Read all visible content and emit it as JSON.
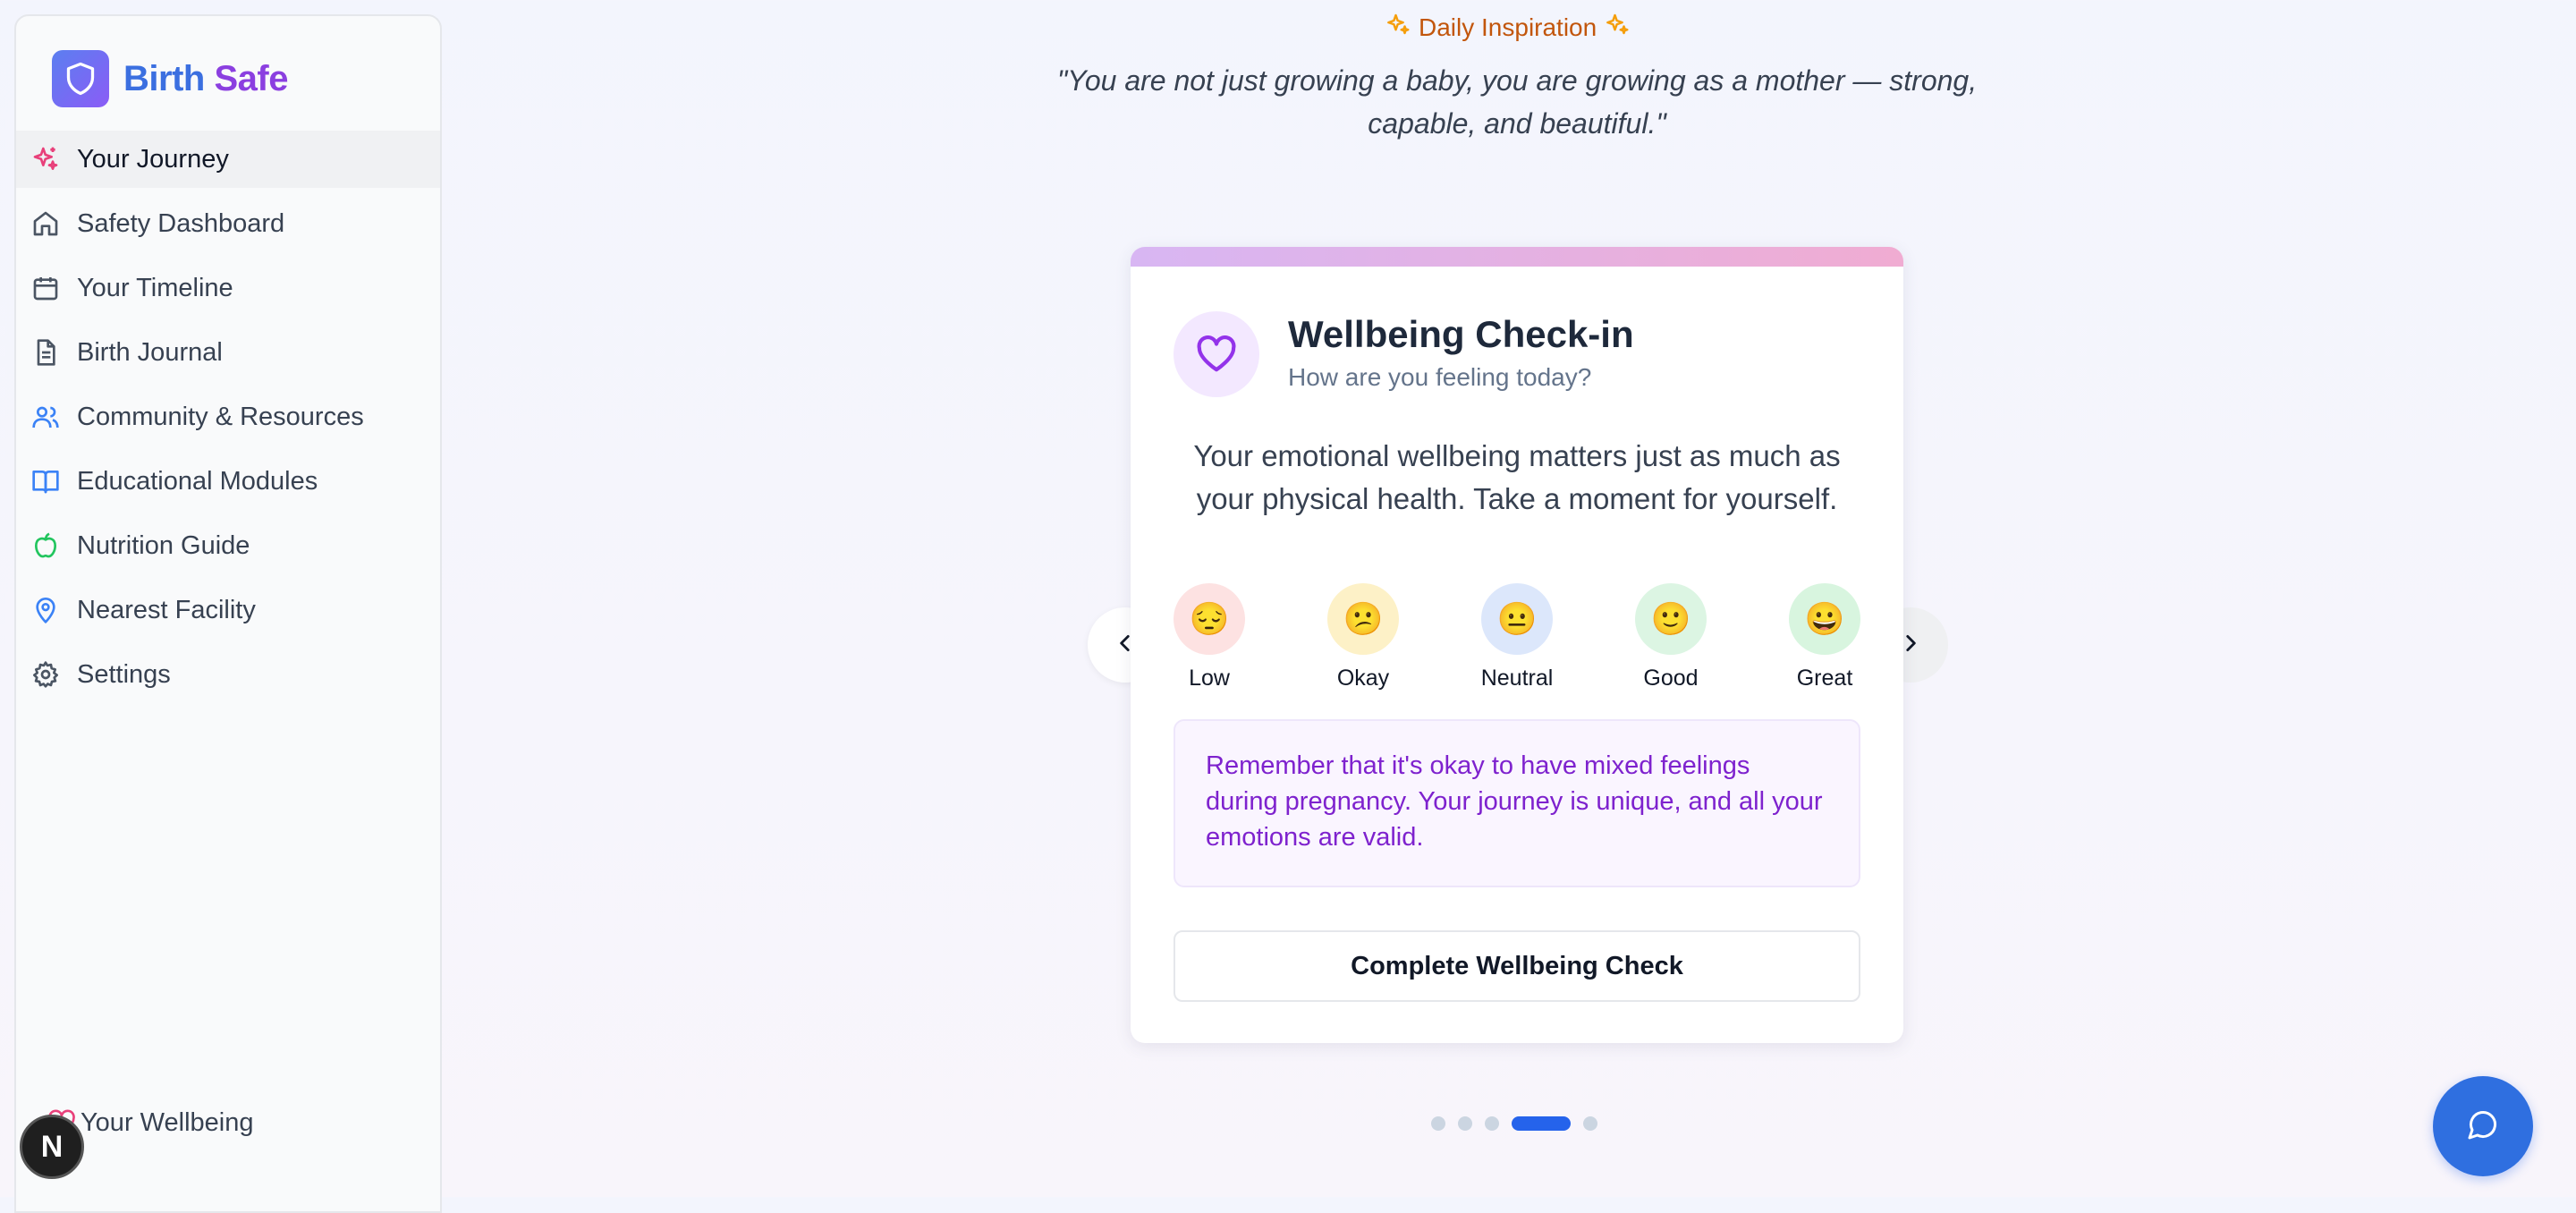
{
  "app": {
    "name_part1": "Birth",
    "name_part2": "Safe"
  },
  "sidebar": {
    "items": [
      {
        "label": "Your Journey",
        "icon": "sparkles-icon"
      },
      {
        "label": "Safety Dashboard",
        "icon": "home-icon"
      },
      {
        "label": "Your Timeline",
        "icon": "calendar-icon"
      },
      {
        "label": "Birth Journal",
        "icon": "document-icon"
      },
      {
        "label": "Community & Resources",
        "icon": "users-icon"
      },
      {
        "label": "Educational Modules",
        "icon": "book-icon"
      },
      {
        "label": "Nutrition Guide",
        "icon": "apple-icon"
      },
      {
        "label": "Nearest Facility",
        "icon": "map-pin-icon"
      },
      {
        "label": "Settings",
        "icon": "gear-icon"
      }
    ],
    "footer_label": "Your Wellbeing",
    "badge_letter": "N"
  },
  "inspiration": {
    "label": "Daily Inspiration",
    "quote": "\"You are not just growing a baby, you are growing as a mother — strong, capable, and beautiful.\""
  },
  "card": {
    "title": "Wellbeing Check-in",
    "subtitle": "How are you feeling today?",
    "body": "Your emotional wellbeing matters just as much as your physical health. Take a moment for yourself.",
    "moods": [
      {
        "emoji": "😔",
        "label": "Low",
        "color": "#fde2e2"
      },
      {
        "emoji": "😕",
        "label": "Okay",
        "color": "#fdf1c7"
      },
      {
        "emoji": "😐",
        "label": "Neutral",
        "color": "#dce7fb"
      },
      {
        "emoji": "🙂",
        "label": "Good",
        "color": "#dcf5e3"
      },
      {
        "emoji": "😀",
        "label": "Great",
        "color": "#d8f5df"
      }
    ],
    "tip": "Remember that it's okay to have mixed feelings during pregnancy. Your journey is unique, and all your emotions are valid.",
    "cta_label": "Complete Wellbeing Check"
  },
  "carousel": {
    "total": 5,
    "active_index": 3
  },
  "colors": {
    "primary": "#2563eb",
    "accent_purple": "#8b5cf6",
    "inspiration_orange": "#c2560c"
  }
}
